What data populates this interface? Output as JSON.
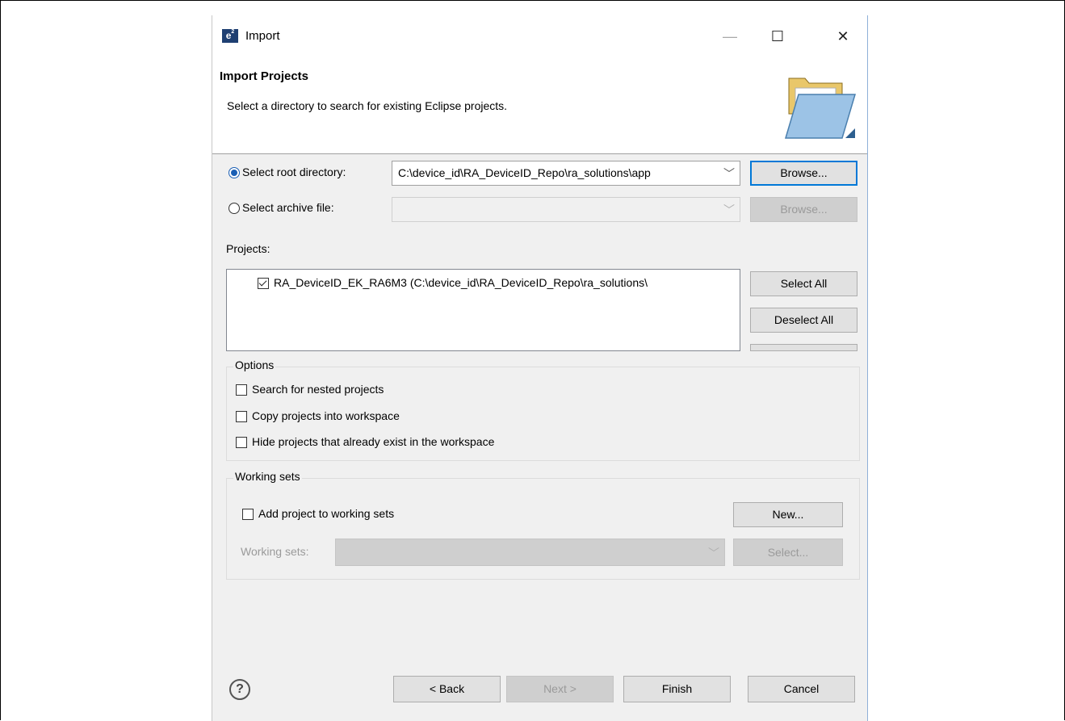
{
  "window": {
    "app_icon": "e",
    "app_icon_sup": "2",
    "title": "Import",
    "min_glyph": "—",
    "max_glyph": "☐",
    "close_glyph": "✕"
  },
  "header": {
    "title": "Import Projects",
    "description": "Select a directory to search for existing Eclipse projects.",
    "icon": "folder-open-icon"
  },
  "source": {
    "root_label": "Select root directory:",
    "root_value": "C:\\device_id\\RA_DeviceID_Repo\\ra_solutions\\app",
    "root_selected": true,
    "archive_label": "Select archive file:",
    "archive_value": "",
    "browse_label": "Browse..."
  },
  "projects": {
    "label": "Projects:",
    "items": [
      {
        "name": "RA_DeviceID_EK_RA6M3 (C:\\device_id\\RA_DeviceID_Repo\\ra_solutions\\",
        "checked": true
      }
    ],
    "select_all_label": "Select All",
    "deselect_all_label": "Deselect All"
  },
  "options": {
    "title": "Options",
    "items": [
      {
        "label": "Search for nested projects",
        "checked": false
      },
      {
        "label": "Copy projects into workspace",
        "checked": false
      },
      {
        "label": "Hide projects that already exist in the workspace",
        "checked": false
      }
    ]
  },
  "working_sets": {
    "title": "Working sets",
    "add_label": "Add project to working sets",
    "new_label": "New...",
    "sets_label": "Working sets:",
    "select_label": "Select..."
  },
  "footer": {
    "help_glyph": "?",
    "back_label": "< Back",
    "next_label": "Next >",
    "finish_label": "Finish",
    "cancel_label": "Cancel"
  }
}
